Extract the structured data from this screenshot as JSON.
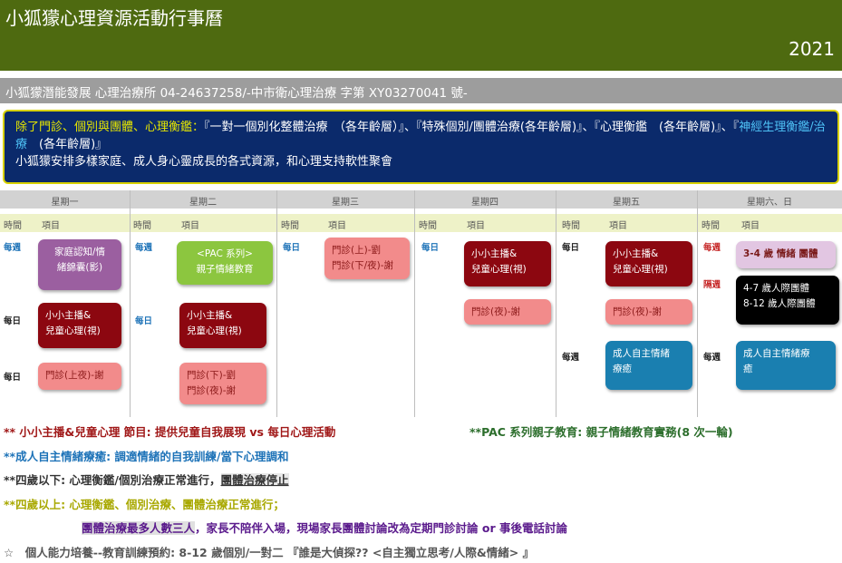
{
  "header": {
    "title": "小狐獴心理資源活動行事曆",
    "year": "2021"
  },
  "subbar": "小狐獴潛能發展 心理治療所 04-24637258/-中市衛心理治療 字第 XY03270041 號-",
  "intro": {
    "part1": "除了門診、個別與團體、心理衡鑑：",
    "part2": "『一對一個別化整體治療　（各年齡層）』、『特殊個別/團體治療(各年齡層)』、『心理衡鑑　(各年齡層)』、『",
    "part3": "神經生理衡鑑/治療",
    "part4": "　(各年齡層)』",
    "line2": "小狐獴安排多樣家庭、成人身心靈成長的各式資源，和心理支持軟性聚會"
  },
  "days": [
    "星期一",
    "星期二",
    "星期三",
    "星期四",
    "星期五",
    "星期六、日"
  ],
  "sub_time": "時間",
  "sub_item": "項目",
  "time_labels": {
    "weekly": "每週",
    "daily": "每日",
    "biweekly": "隔週"
  },
  "cards": {
    "mon_family": [
      "家庭認知/情",
      "緒錦囊(影)"
    ],
    "mon_kids": [
      "小小主播&",
      "兒童心理(視)"
    ],
    "mon_clinic": "門診(上夜)-謝",
    "tue_pac": [
      "<PAC 系列>",
      "親子情緒教育"
    ],
    "tue_kids": [
      "小小主播&",
      "兒童心理(視)"
    ],
    "tue_clinic": [
      "門診(下)-劉",
      "門診(夜)-謝"
    ],
    "wed_clinic": [
      "門診(上)-劉",
      "門診(下/夜)-謝"
    ],
    "thu_kids": [
      "小小主播&",
      "兒童心理(視)"
    ],
    "thu_clinic": "門診(夜)-謝",
    "fri_kids": [
      "小小主播&",
      "兒童心理(視)"
    ],
    "fri_clinic": "門診(夜)-謝",
    "fri_adult": [
      "成人自主情緒",
      "療癒"
    ],
    "sat_emotion": "3-4 歲 情緒 團體",
    "sat_social": [
      "4-7 歲人際團體",
      "8-12 歲人際團體"
    ],
    "sat_adult": [
      "成人自主情緒療",
      "癒"
    ]
  },
  "notes": {
    "n1": "** 小小主播&兒童心理 節目: 提供兒童自我展現 vs 每日心理活動",
    "n1b": "**PAC 系列親子教育: 親子情緒教育實務(8 次一輪)",
    "n2": "**成人自主情緒療癒: 調適情緒的自我訓練/當下心理調和",
    "n3a": "**四歲以下: 心理衡鑑/個別治療正常進行，",
    "n3b": "團體治療停止",
    "n4": "**四歲以上: 心理衡鑑、個別治療、團體治療正常進行；",
    "n5a": "團體治療最多人數三人",
    "n5b": "，家長不陪伴入場，現場家長團體討論改為定期門診討論 or 事後電話討論",
    "n6": "☆　個人能力培養--教育訓練預約: 8-12 歲個別/一對二 『誰是大偵探?? <自主獨立思考/人際&情緒> 』"
  },
  "colors": {
    "header": "#4e6a10",
    "intro_bg": "#0b2a6b",
    "maroon": "#8c0710",
    "salmon": "#f28b8b",
    "purple": "#9b5fa0",
    "green": "#8cc63f",
    "teal": "#1a7fb0"
  }
}
